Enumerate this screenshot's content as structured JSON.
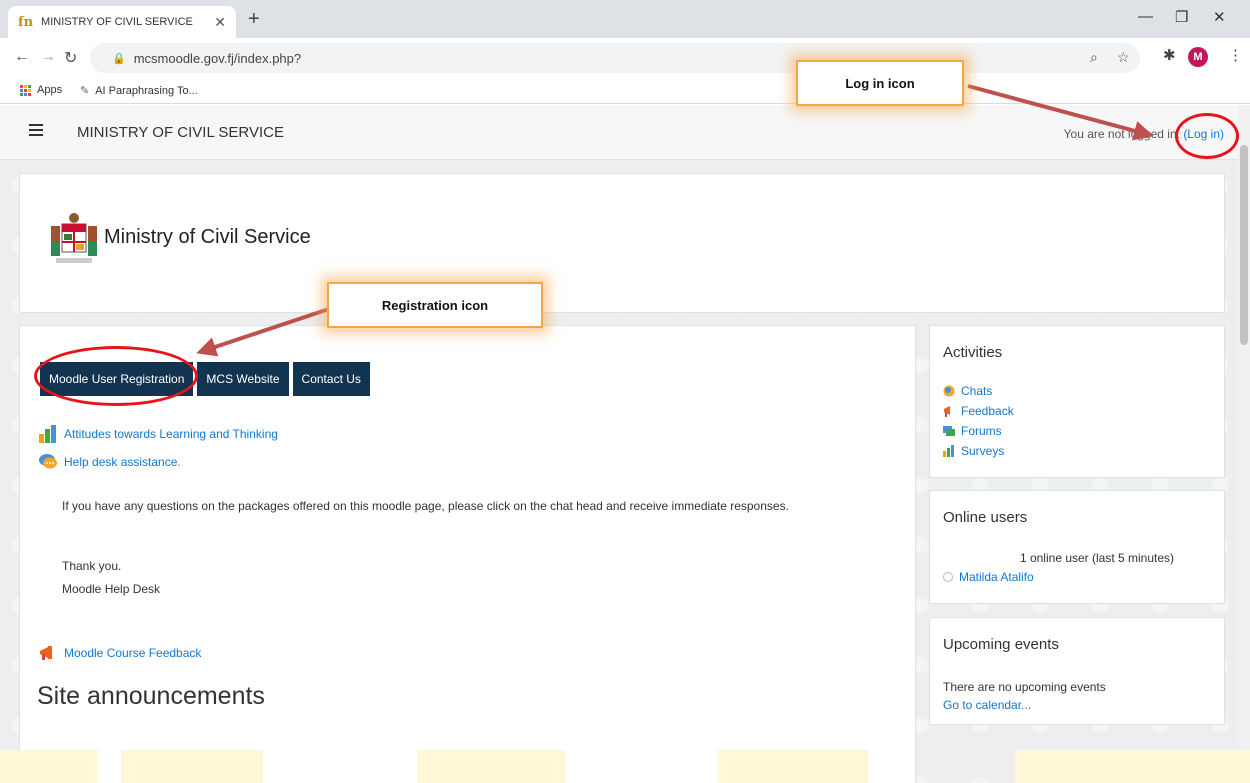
{
  "browser": {
    "tab_title": "MINISTRY OF CIVIL SERVICE",
    "tab_favicon": "fn",
    "new_tab": "+",
    "url": "mcsmoodle.gov.fj/index.php?",
    "avatar_letter": "M",
    "bookmarks": [
      {
        "label": "Apps",
        "icon": "apps-grid-icon"
      },
      {
        "label": "AI Paraphrasing To...",
        "icon": "feather-icon"
      }
    ]
  },
  "navbar": {
    "site_name": "MINISTRY OF CIVIL SERVICE",
    "login_prefix": "You are not logged in.",
    "login_link": "(Log in)"
  },
  "header": {
    "logo_text": "Ministry of Civil Service"
  },
  "main": {
    "buttons": [
      {
        "label": "Moodle User Registration"
      },
      {
        "label": "MCS Website"
      },
      {
        "label": "Contact Us"
      }
    ],
    "activities": [
      {
        "label": "Attitudes towards Learning and Thinking",
        "icon": "survey-icon"
      },
      {
        "label": "Help desk assistance.",
        "icon": "chat-icon"
      }
    ],
    "help_text": "If you have any questions on the packages offered on this moodle page, please click on the chat head and receive immediate responses.",
    "thanks": "Thank you.",
    "signature": "Moodle Help Desk",
    "feedback_link": "Moodle Course Feedback",
    "announcements_heading": "Site announcements"
  },
  "sidebar": {
    "activities": {
      "title": "Activities",
      "items": [
        {
          "label": "Chats",
          "icon": "chat-icon"
        },
        {
          "label": "Feedback",
          "icon": "feedback-icon"
        },
        {
          "label": "Forums",
          "icon": "forum-icon"
        },
        {
          "label": "Surveys",
          "icon": "survey-icon"
        }
      ]
    },
    "online_users": {
      "title": "Online users",
      "summary": "1 online user (last 5 minutes)",
      "users": [
        "Matilda Atalifo"
      ]
    },
    "upcoming": {
      "title": "Upcoming events",
      "empty_text": "There are no upcoming events",
      "calendar_link": "Go to calendar..."
    }
  },
  "annotations": {
    "login_callout": "Log in icon",
    "registration_callout": "Registration icon"
  },
  "colors": {
    "button_bg": "#133451",
    "link": "#1177d1",
    "annotation_red": "#e8141c",
    "annotation_arrow": "#c0504d",
    "callout_glow": "#f3a54a"
  }
}
